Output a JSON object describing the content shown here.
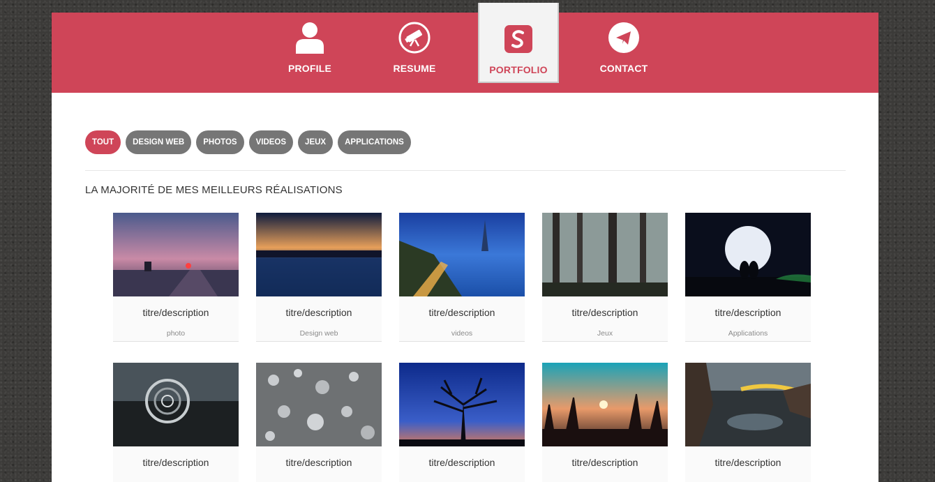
{
  "nav": {
    "items": [
      {
        "label": "PROFILE",
        "icon": "user-icon"
      },
      {
        "label": "RESUME",
        "icon": "telescope-icon"
      },
      {
        "label": "PORTFOLIO",
        "icon": "portfolio-logo-icon",
        "active": true
      },
      {
        "label": "CONTACT",
        "icon": "paper-plane-icon"
      }
    ]
  },
  "filters": [
    "TOUT",
    "DESIGN WEB",
    "PHOTOS",
    "VIDEOS",
    "JEUX",
    "APPLICATIONS"
  ],
  "active_filter": "TOUT",
  "section_title": "LA MAJORITÉ DE MES MEILLEURS RÉALISATIONS",
  "items": [
    {
      "title": "titre/description",
      "category": "photo"
    },
    {
      "title": "titre/description",
      "category": "Design web"
    },
    {
      "title": "titre/description",
      "category": "videos"
    },
    {
      "title": "titre/description",
      "category": "Jeux"
    },
    {
      "title": "titre/description",
      "category": "Applications"
    },
    {
      "title": "titre/description",
      "category": ""
    },
    {
      "title": "titre/description",
      "category": ""
    },
    {
      "title": "titre/description",
      "category": ""
    },
    {
      "title": "titre/description",
      "category": ""
    },
    {
      "title": "titre/description",
      "category": ""
    }
  ],
  "colors": {
    "accent": "#cf4558",
    "pill": "#767676",
    "background": "#3b3a38"
  }
}
